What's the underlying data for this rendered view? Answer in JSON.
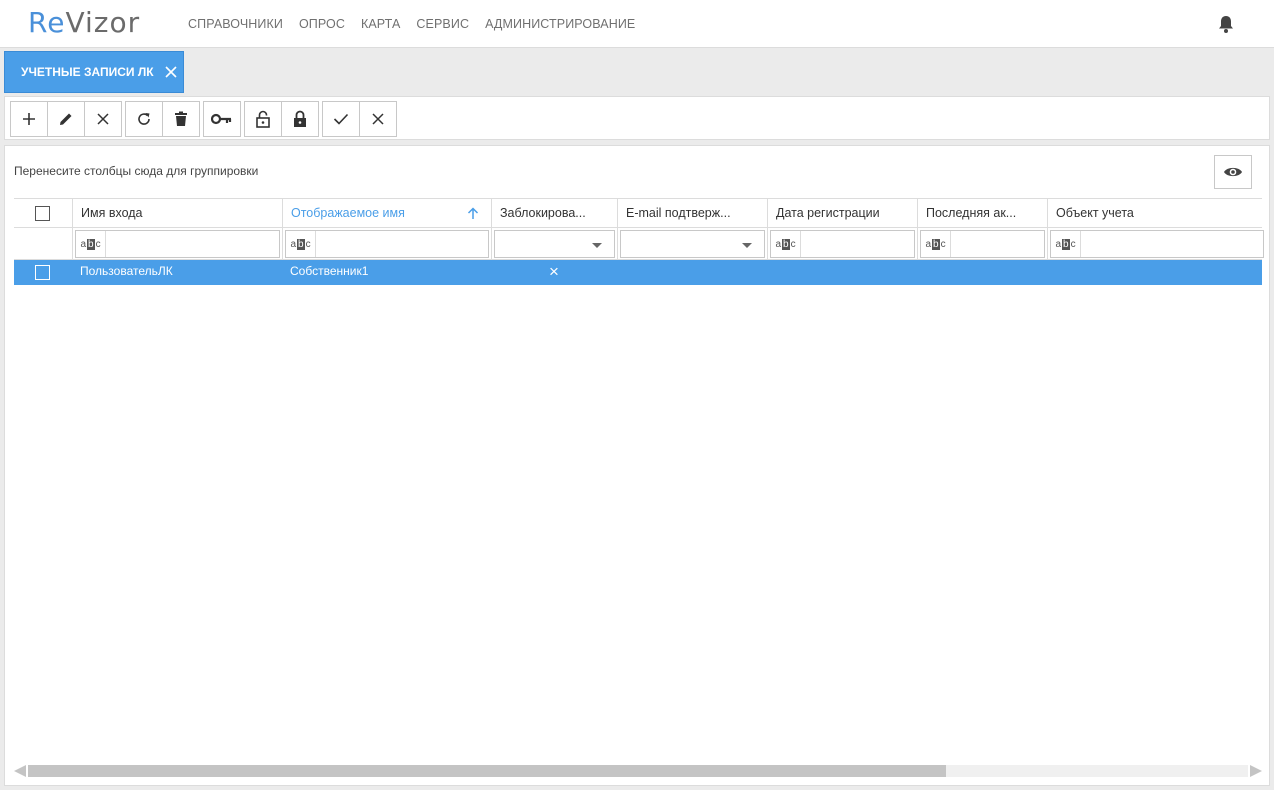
{
  "brand": {
    "re": "Re",
    "vizor": "Vizor"
  },
  "nav": [
    "СПРАВОЧНИКИ",
    "ОПРОС",
    "КАРТА",
    "СЕРВИС",
    "АДМИНИСТРИРОВАНИЕ"
  ],
  "tab": {
    "label": "УЧЕТНЫЕ ЗАПИСИ ЛК"
  },
  "toolbar": [
    "add-icon",
    "edit-icon",
    "cancel-icon",
    "refresh-icon",
    "delete-icon",
    "key-icon",
    "unlock-icon",
    "lock-icon",
    "check-icon",
    "close-icon"
  ],
  "grid": {
    "group_hint": "Перенесите столбцы сюда для группировки",
    "columns": [
      "Имя входа",
      "Отображаемое имя",
      "Заблокирова...",
      "E-mail подтверж...",
      "Дата регистрации",
      "Последняя ак...",
      "Объект учета"
    ],
    "sorted_column": "Отображаемое имя",
    "rows": [
      {
        "login": "ПользовательЛК",
        "display_name": "Собственник1",
        "blocked": "×"
      }
    ]
  },
  "colors": {
    "accent": "#4a9ee8",
    "brand_blue": "#4a90d9"
  }
}
